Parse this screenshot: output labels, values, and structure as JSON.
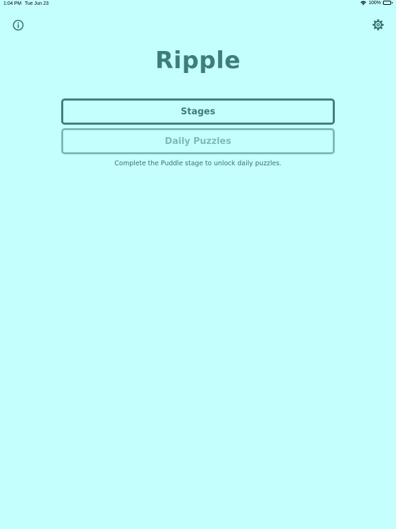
{
  "status_bar": {
    "time": "1:04 PM",
    "date": "Tue Jun 23",
    "battery": "100%",
    "battery_level": 1.0
  },
  "header": {
    "info_icon": "info-icon",
    "settings_icon": "gear-icon"
  },
  "main": {
    "title": "Ripple",
    "stages_label": "Stages",
    "daily_label": "Daily Puzzles",
    "hint": "Complete the Puddle stage to unlock daily puzzles."
  },
  "colors": {
    "background": "#c4fffd",
    "accent": "#3d7d7a",
    "disabled": "#7cbbb7"
  }
}
